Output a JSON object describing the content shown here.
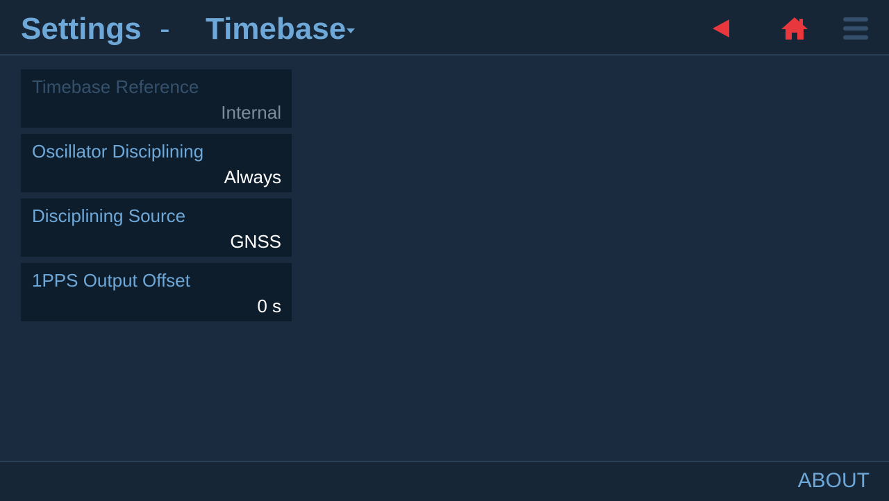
{
  "header": {
    "section_title": "Settings",
    "separator": "-",
    "page_title": "Timebase",
    "icons": {
      "back": "back-triangle-icon",
      "home": "home-icon",
      "menu": "hamburger-menu-icon"
    },
    "colors": {
      "accent": "#6ea8d8",
      "alert_red": "#e8383d"
    }
  },
  "settings": [
    {
      "label": "Timebase Reference",
      "value": "Internal",
      "enabled": false
    },
    {
      "label": "Oscillator Disciplining",
      "value": "Always",
      "enabled": true
    },
    {
      "label": "Disciplining Source",
      "value": "GNSS",
      "enabled": true
    },
    {
      "label": "1PPS Output Offset",
      "value": "0 s",
      "enabled": true
    }
  ],
  "footer": {
    "about_label": "ABOUT"
  }
}
